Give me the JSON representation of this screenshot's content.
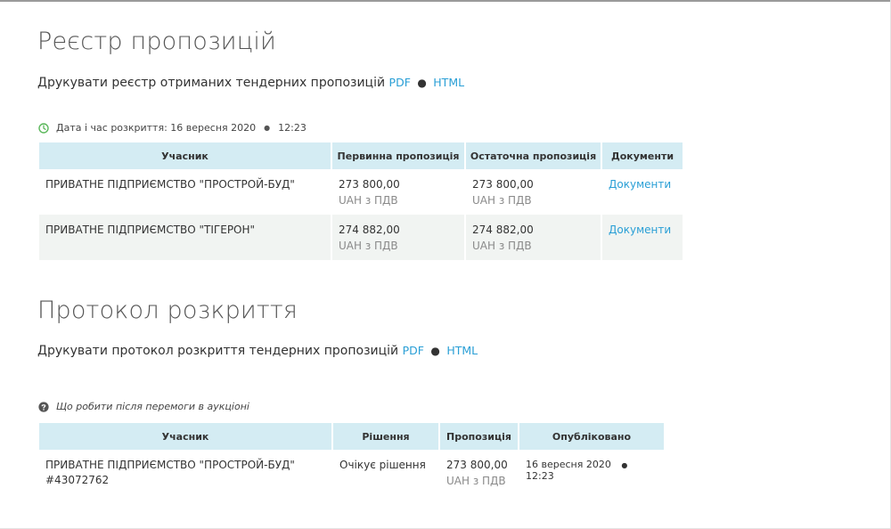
{
  "registry": {
    "title": "Реєстр пропозицій",
    "print_text": "Друкувати реєстр отриманих тендерних пропозицій",
    "pdf_label": "PDF",
    "html_label": "HTML",
    "separator": "●",
    "opening_label": "Дата і час розкриття: 16 вересня 2020",
    "opening_time": "12:23",
    "columns": [
      "Учасник",
      "Первинна пропозиція",
      "Остаточна пропозиція",
      "Документи"
    ],
    "rows": [
      {
        "participant": "ПРИВАТНЕ ПІДПРИЄМСТВО \"ПРОСТРОЙ-БУД\"",
        "initial": "273 800,00",
        "initial_note": "UAH з ПДВ",
        "final": "273 800,00",
        "final_note": "UAH з ПДВ",
        "docs": "Документи"
      },
      {
        "participant": "ПРИВАТНЕ ПІДПРИЄМСТВО \"ТІГЕРОН\"",
        "initial": "274 882,00",
        "initial_note": "UAH з ПДВ",
        "final": "274 882,00",
        "final_note": "UAH з ПДВ",
        "docs": "Документи"
      }
    ]
  },
  "protocol": {
    "title": "Протокол розкриття",
    "print_text": "Друкувати протокол розкриття тендерних пропозицій",
    "pdf_label": "PDF",
    "html_label": "HTML",
    "separator": "●",
    "help_text": "Що робити після перемоги в аукціоні",
    "columns": [
      "Учасник",
      "Рішення",
      "Пропозиція",
      "Опубліковано"
    ],
    "rows": [
      {
        "participant": "ПРИВАТНЕ ПІДПРИЄМСТВО \"ПРОСТРОЙ-БУД\"",
        "code": "#43072762",
        "decision": "Очікує рішення",
        "offer": "273 800,00",
        "offer_note": "UAH з ПДВ",
        "published_date": "16 вересня 2020",
        "published_time": "12:23"
      }
    ]
  },
  "colors": {
    "accent": "#2a9fd6",
    "header_bg": "#d4ecf3",
    "clock": "#5cb85c"
  },
  "icons": {
    "clock": "clock-icon",
    "help": "question-circle-icon"
  }
}
